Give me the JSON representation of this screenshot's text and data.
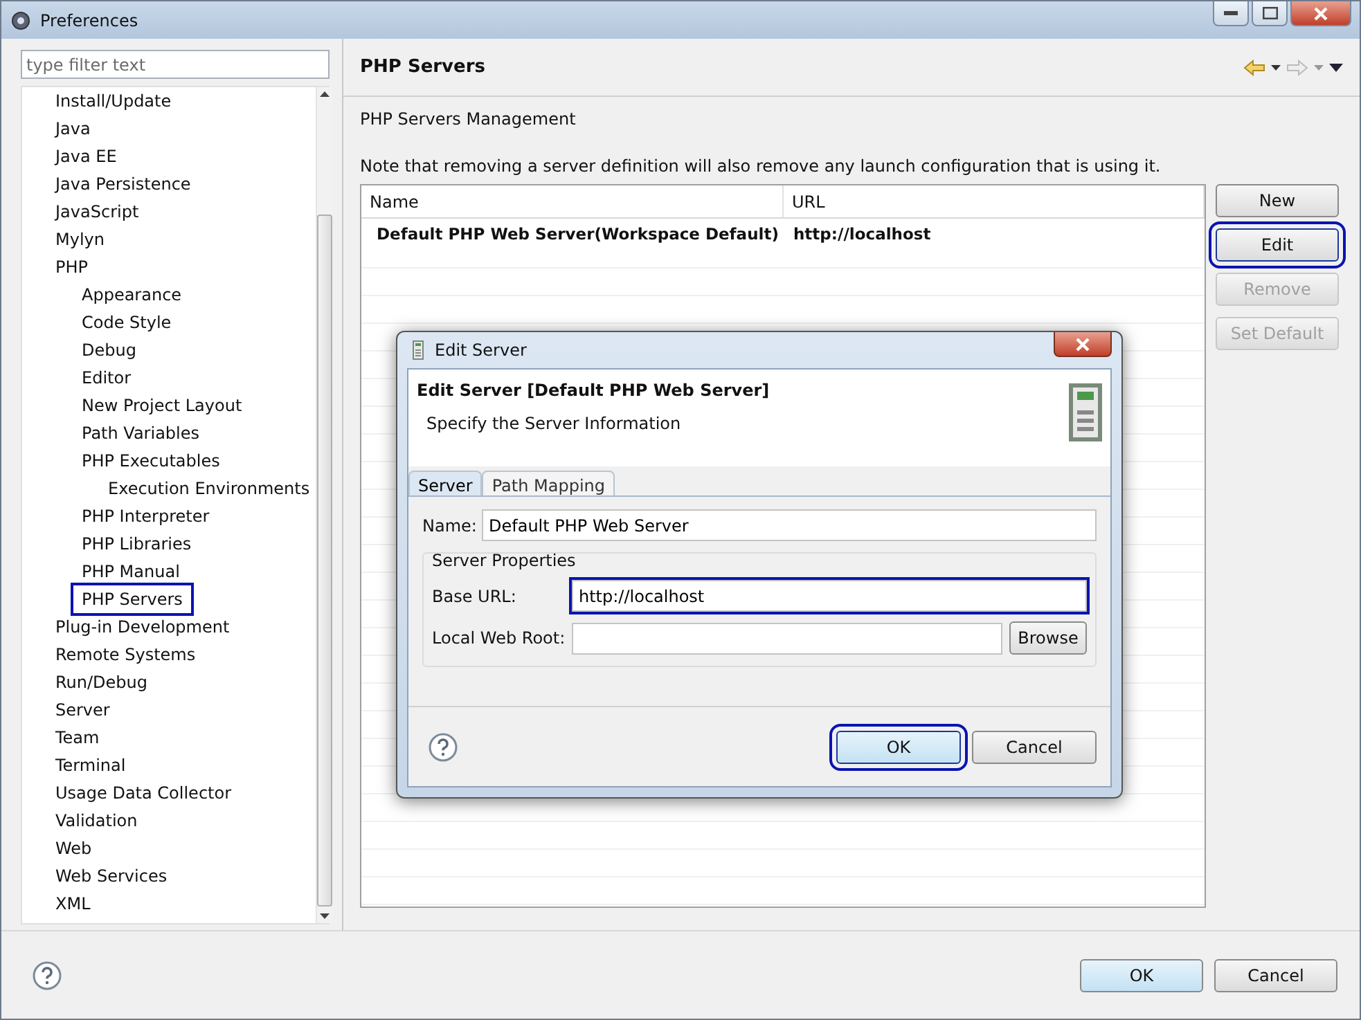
{
  "window": {
    "title": "Preferences"
  },
  "filter": {
    "placeholder": "type filter text"
  },
  "tree": [
    {
      "label": "Install/Update",
      "highlighted": false
    },
    {
      "label": "Java",
      "highlighted": false
    },
    {
      "label": "Java EE",
      "highlighted": false
    },
    {
      "label": "Java Persistence",
      "highlighted": false
    },
    {
      "label": "JavaScript",
      "highlighted": false
    },
    {
      "label": "Mylyn",
      "highlighted": false
    },
    {
      "label": "PHP",
      "highlighted": false,
      "children": [
        {
          "label": "Appearance",
          "highlighted": false
        },
        {
          "label": "Code Style",
          "highlighted": false
        },
        {
          "label": "Debug",
          "highlighted": false
        },
        {
          "label": "Editor",
          "highlighted": false
        },
        {
          "label": "New Project Layout",
          "highlighted": false
        },
        {
          "label": "Path Variables",
          "highlighted": false
        },
        {
          "label": "PHP Executables",
          "highlighted": false,
          "children": [
            {
              "label": "Execution Environments",
              "highlighted": false
            }
          ]
        },
        {
          "label": "PHP Interpreter",
          "highlighted": false
        },
        {
          "label": "PHP Libraries",
          "highlighted": false
        },
        {
          "label": "PHP Manual",
          "highlighted": false
        },
        {
          "label": "PHP Servers",
          "highlighted": true
        }
      ]
    },
    {
      "label": "Plug-in Development",
      "highlighted": false
    },
    {
      "label": "Remote Systems",
      "highlighted": false
    },
    {
      "label": "Run/Debug",
      "highlighted": false
    },
    {
      "label": "Server",
      "highlighted": false
    },
    {
      "label": "Team",
      "highlighted": false
    },
    {
      "label": "Terminal",
      "highlighted": false
    },
    {
      "label": "Usage Data Collector",
      "highlighted": false
    },
    {
      "label": "Validation",
      "highlighted": false
    },
    {
      "label": "Web",
      "highlighted": false
    },
    {
      "label": "Web Services",
      "highlighted": false
    },
    {
      "label": "XML",
      "highlighted": false
    }
  ],
  "page": {
    "title": "PHP Servers",
    "subtitle": "PHP Servers Management",
    "note": "Note that removing a server definition will also remove any launch configuration that is using it."
  },
  "table": {
    "columns": [
      "Name",
      "URL"
    ],
    "rows": [
      {
        "cells": [
          "Default PHP Web Server(Workspace Default)",
          "http://localhost"
        ],
        "selected": false
      }
    ]
  },
  "side_buttons": [
    {
      "label": "New",
      "disabled": false,
      "highlighted": false
    },
    {
      "label": "Edit",
      "disabled": false,
      "highlighted": true
    },
    {
      "label": "Remove",
      "disabled": true,
      "highlighted": false
    },
    {
      "label": "Set Default",
      "disabled": true,
      "highlighted": false
    }
  ],
  "dialog": {
    "title": "Edit Server",
    "heading": "Edit Server [Default PHP Web Server]",
    "description": "Specify the Server Information",
    "tabs": [
      {
        "label": "Server",
        "selected": true
      },
      {
        "label": "Path Mapping",
        "selected": false
      }
    ],
    "name_label": "Name:",
    "name_value": "Default PHP Web Server",
    "group_label": "Server Properties",
    "base_url_label": "Base URL:",
    "base_url_value": "http://localhost",
    "base_url_highlighted": true,
    "web_root_label": "Local Web Root:",
    "browse": "Browse",
    "buttons": [
      {
        "label": "OK",
        "highlighted": true
      },
      {
        "label": "Cancel",
        "highlighted": false
      }
    ]
  },
  "footer": {
    "buttons": [
      {
        "label": "OK"
      },
      {
        "label": "Cancel"
      }
    ]
  }
}
